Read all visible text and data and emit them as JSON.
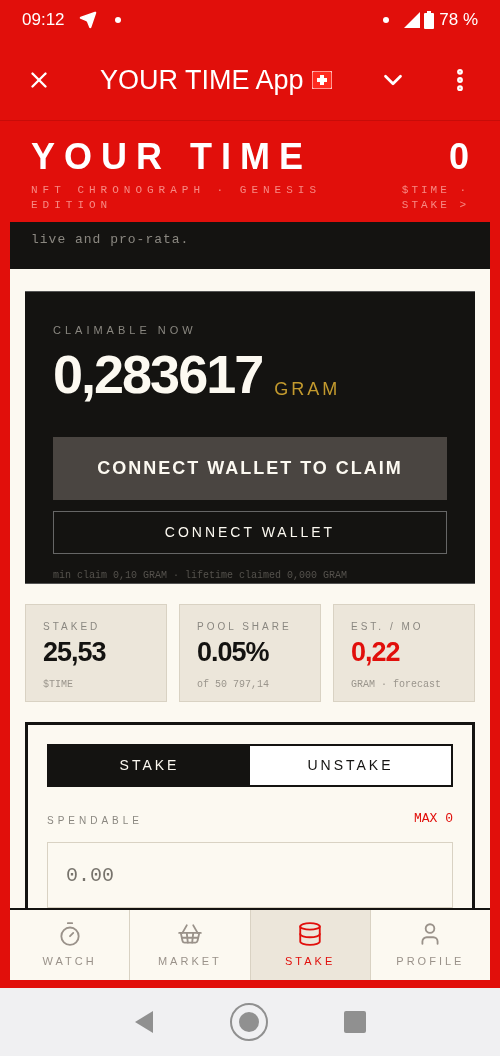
{
  "status_bar": {
    "time": "09:12",
    "battery": "78 %"
  },
  "app_bar": {
    "title": "YOUR TIME App"
  },
  "header": {
    "title": "YOUR TIME",
    "subtitle": "NFT CHRONOGRAPH · GENESIS EDITION",
    "balance": "0",
    "balance_link": "$TIME · STAKE >"
  },
  "intro": {
    "text": "live and pro-rata."
  },
  "claim": {
    "label": "CLAIMABLE NOW",
    "amount": "0,283617",
    "unit": "GRAM",
    "primary_button": "CONNECT WALLET TO CLAIM",
    "secondary_button": "CONNECT WALLET",
    "note": "min claim 0,10 GRAM · lifetime claimed 0,000 GRAM"
  },
  "stats": [
    {
      "label": "STAKED",
      "value": "25,53",
      "sub": "$TIME",
      "kind": "normal"
    },
    {
      "label": "POOL SHARE",
      "value": "0.05%",
      "sub": "of 50 797,14",
      "kind": "normal"
    },
    {
      "label": "EST. / MO",
      "value": "0,22",
      "sub": "GRAM · forecast",
      "kind": "accent"
    }
  ],
  "stake_panel": {
    "tabs": [
      {
        "label": "STAKE",
        "selected": true
      },
      {
        "label": "UNSTAKE",
        "selected": false
      }
    ],
    "field_label": "SPENDABLE",
    "max_link": "MAX 0",
    "amount_field": {
      "placeholder": "0.00"
    }
  },
  "bottom_nav": [
    {
      "label": "WATCH",
      "selected": false
    },
    {
      "label": "MARKET",
      "selected": false
    },
    {
      "label": "STAKE",
      "selected": true
    },
    {
      "label": "PROFILE",
      "selected": false
    }
  ]
}
